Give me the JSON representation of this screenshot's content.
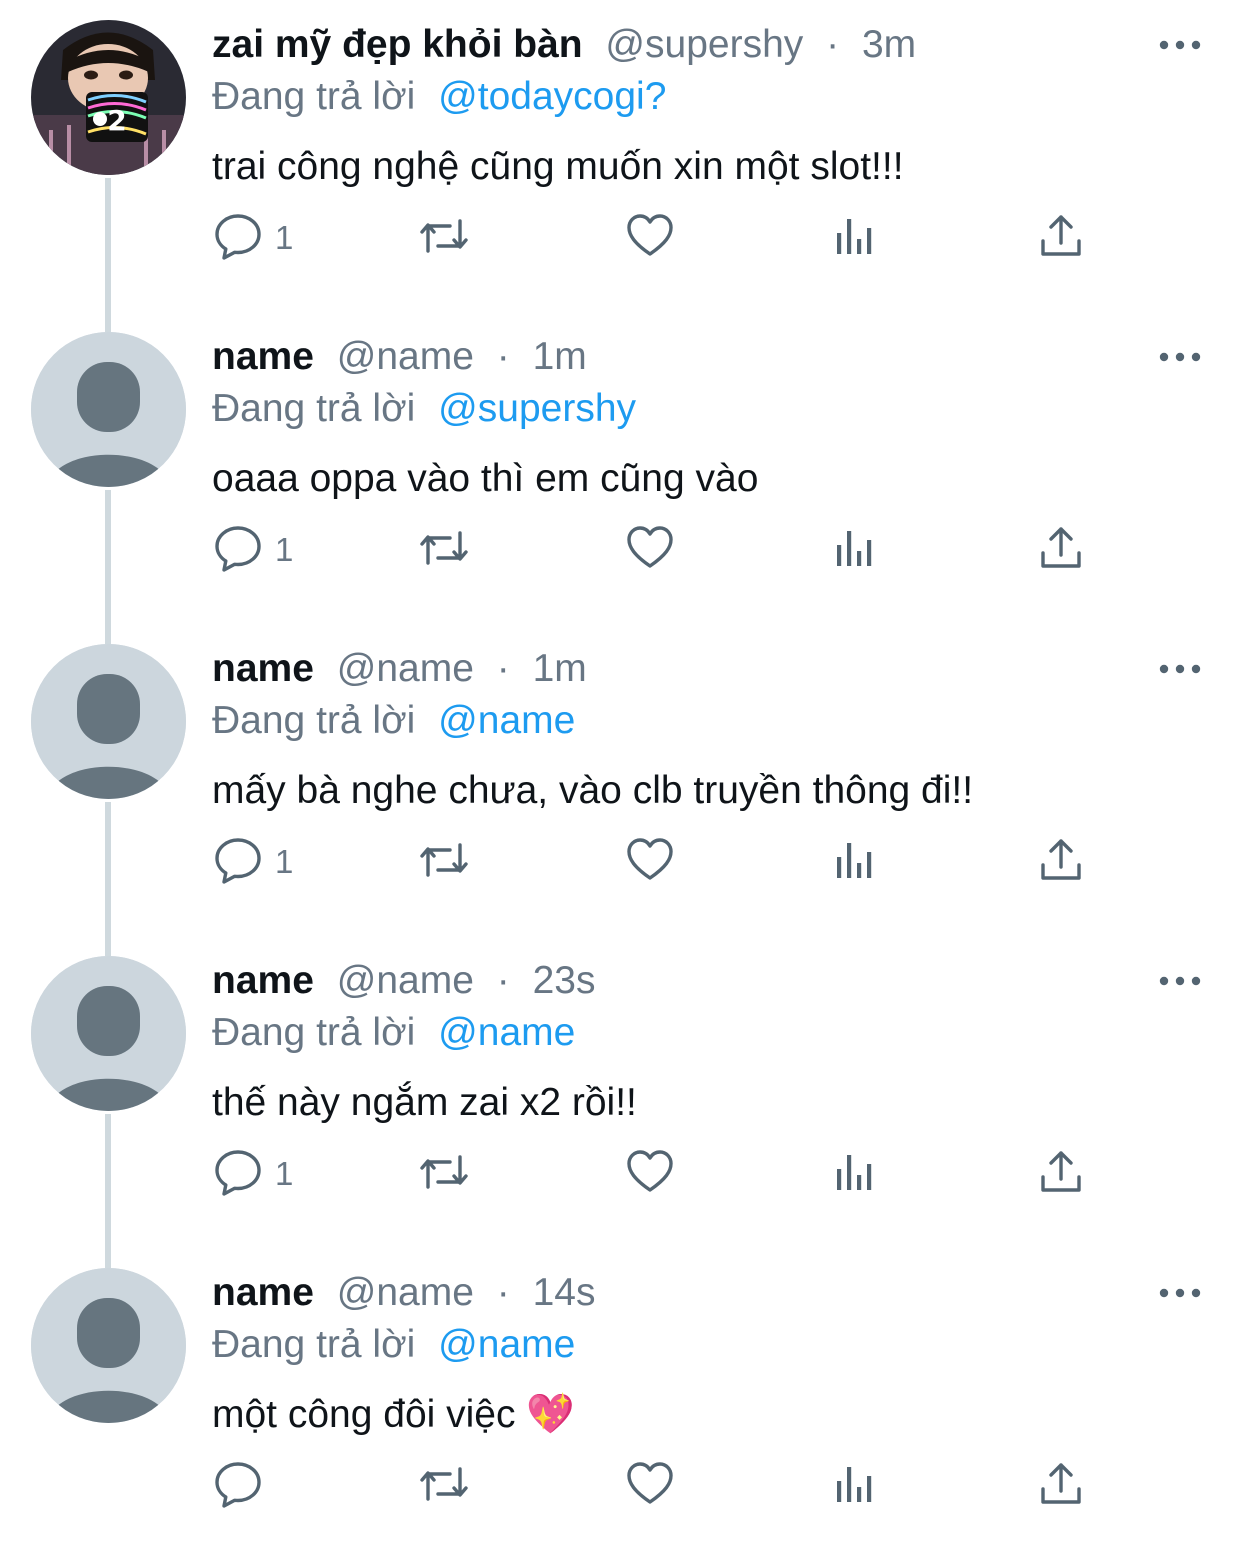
{
  "tweets": [
    {
      "display_name": "zai mỹ đẹp khỏi bàn",
      "handle": "@supershy",
      "separator": "·",
      "time": "3m",
      "replying_prefix": "Đang trả lời",
      "replying_to": "@todaycogi?",
      "text": "trai công nghệ cũng muốn xin một slot!!!",
      "reply_count": "1",
      "avatar": "photo"
    },
    {
      "display_name": "name",
      "handle": "@name",
      "separator": "·",
      "time": "1m",
      "replying_prefix": "Đang trả lời",
      "replying_to": "@supershy",
      "text": "oaaa oppa vào thì em cũng vào",
      "reply_count": "1",
      "avatar": "default"
    },
    {
      "display_name": "name",
      "handle": "@name",
      "separator": "·",
      "time": "1m",
      "replying_prefix": "Đang trả lời",
      "replying_to": "@name",
      "text": "mấy bà nghe chưa, vào clb truyền thông đi!!",
      "reply_count": "1",
      "avatar": "default"
    },
    {
      "display_name": "name",
      "handle": "@name",
      "separator": "·",
      "time": "23s",
      "replying_prefix": "Đang trả lời",
      "replying_to": "@name",
      "text": "thế này ngắm zai x2 rồi!!",
      "reply_count": "1",
      "avatar": "default"
    },
    {
      "display_name": "name",
      "handle": "@name",
      "separator": "·",
      "time": "14s",
      "replying_prefix": "Đang trả lời",
      "replying_to": "@name",
      "text": "một công đôi việc 💖",
      "reply_count": "",
      "avatar": "default"
    }
  ],
  "icons": {
    "reply": "reply-icon",
    "retweet": "retweet-icon",
    "like": "heart-icon",
    "analytics": "analytics-icon",
    "share": "share-icon",
    "more": "more-icon"
  },
  "colors": {
    "text": "#0f1419",
    "secondary": "#687684",
    "mention": "#1d9bf0",
    "thread_line": "#cfd9de",
    "default_avatar_bg": "#ccd6dd",
    "default_avatar_fg": "#66757f"
  }
}
